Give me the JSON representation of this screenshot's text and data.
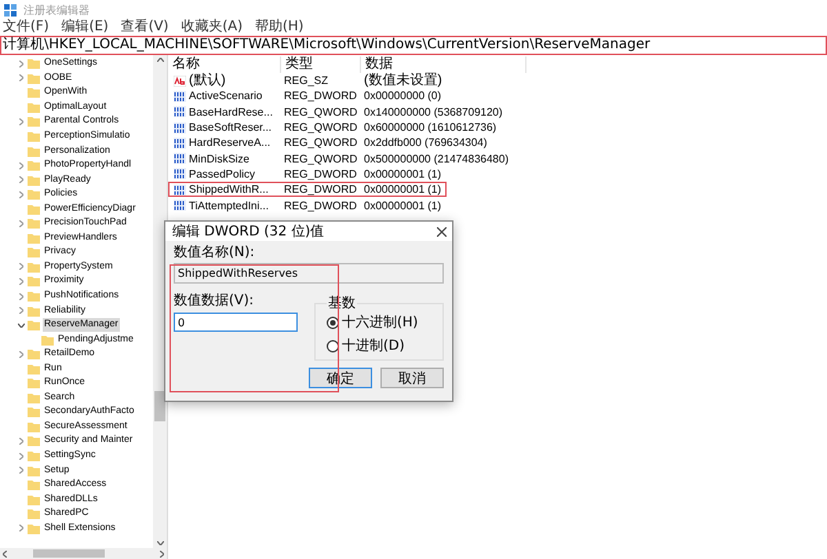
{
  "window": {
    "title": "注册表编辑器"
  },
  "menu": [
    "文件(F)",
    "编辑(E)",
    "查看(V)",
    "收藏夹(A)",
    "帮助(H)"
  ],
  "address": {
    "value": "计算机\\HKEY_LOCAL_MACHINE\\SOFTWARE\\Microsoft\\Windows\\CurrentVersion\\ReserveManager",
    "highlighted": true
  },
  "tree": [
    {
      "label": "OneSettings",
      "kind": "collapsed",
      "selected": false
    },
    {
      "label": "OOBE",
      "kind": "collapsed",
      "selected": false
    },
    {
      "label": "OpenWith",
      "kind": "leaf",
      "selected": false
    },
    {
      "label": "OptimalLayout",
      "kind": "leaf",
      "selected": false
    },
    {
      "label": "Parental Controls",
      "kind": "collapsed",
      "selected": false
    },
    {
      "label": "PerceptionSimulatio",
      "kind": "leaf",
      "selected": false
    },
    {
      "label": "Personalization",
      "kind": "leaf",
      "selected": false
    },
    {
      "label": "PhotoPropertyHandl",
      "kind": "collapsed",
      "selected": false
    },
    {
      "label": "PlayReady",
      "kind": "collapsed",
      "selected": false
    },
    {
      "label": "Policies",
      "kind": "collapsed",
      "selected": false
    },
    {
      "label": "PowerEfficiencyDiagr",
      "kind": "leaf",
      "selected": false
    },
    {
      "label": "PrecisionTouchPad",
      "kind": "collapsed",
      "selected": false
    },
    {
      "label": "PreviewHandlers",
      "kind": "leaf",
      "selected": false
    },
    {
      "label": "Privacy",
      "kind": "leaf",
      "selected": false
    },
    {
      "label": "PropertySystem",
      "kind": "collapsed",
      "selected": false
    },
    {
      "label": "Proximity",
      "kind": "collapsed",
      "selected": false
    },
    {
      "label": "PushNotifications",
      "kind": "collapsed",
      "selected": false
    },
    {
      "label": "Reliability",
      "kind": "collapsed",
      "selected": false
    },
    {
      "label": "ReserveManager",
      "kind": "expanded",
      "selected": true,
      "children": [
        {
          "label": "PendingAdjustme",
          "selected": false
        }
      ]
    },
    {
      "label": "RetailDemo",
      "kind": "collapsed",
      "selected": false
    },
    {
      "label": "Run",
      "kind": "leaf",
      "selected": false
    },
    {
      "label": "RunOnce",
      "kind": "leaf",
      "selected": false
    },
    {
      "label": "Search",
      "kind": "leaf",
      "selected": false
    },
    {
      "label": "SecondaryAuthFacto",
      "kind": "leaf",
      "selected": false
    },
    {
      "label": "SecureAssessment",
      "kind": "leaf",
      "selected": false
    },
    {
      "label": "Security and Mainter",
      "kind": "collapsed",
      "selected": false
    },
    {
      "label": "SettingSync",
      "kind": "collapsed",
      "selected": false
    },
    {
      "label": "Setup",
      "kind": "collapsed",
      "selected": false
    },
    {
      "label": "SharedAccess",
      "kind": "leaf",
      "selected": false
    },
    {
      "label": "SharedDLLs",
      "kind": "leaf",
      "selected": false
    },
    {
      "label": "SharedPC",
      "kind": "leaf",
      "selected": false
    },
    {
      "label": "Shell Extensions",
      "kind": "collapsed",
      "selected": false
    }
  ],
  "values": {
    "columns": [
      "名称",
      "类型",
      "数据"
    ],
    "rows": [
      {
        "kind": "string",
        "name": "(默认)",
        "type": "REG_SZ",
        "data": "(数值未设置)",
        "highlighted": false
      },
      {
        "kind": "number",
        "name": "ActiveScenario",
        "type": "REG_DWORD",
        "data": "0x00000000 (0)",
        "highlighted": false
      },
      {
        "kind": "number",
        "name": "BaseHardRese...",
        "type": "REG_QWORD",
        "data": "0x140000000 (5368709120)",
        "highlighted": false
      },
      {
        "kind": "number",
        "name": "BaseSoftReser...",
        "type": "REG_QWORD",
        "data": "0x60000000 (1610612736)",
        "highlighted": false
      },
      {
        "kind": "number",
        "name": "HardReserveA...",
        "type": "REG_QWORD",
        "data": "0x2ddfb000 (769634304)",
        "highlighted": false
      },
      {
        "kind": "number",
        "name": "MinDiskSize",
        "type": "REG_QWORD",
        "data": "0x500000000 (21474836480)",
        "highlighted": false
      },
      {
        "kind": "number",
        "name": "PassedPolicy",
        "type": "REG_DWORD",
        "data": "0x00000001 (1)",
        "highlighted": false
      },
      {
        "kind": "number",
        "name": "ShippedWithR...",
        "type": "REG_DWORD",
        "data": "0x00000001 (1)",
        "highlighted": true
      },
      {
        "kind": "number",
        "name": "TiAttemptedIni...",
        "type": "REG_DWORD",
        "data": "0x00000001 (1)",
        "highlighted": false
      }
    ]
  },
  "dialog": {
    "title": "编辑 DWORD (32 位)值",
    "name_label": "数值名称(N):",
    "name_value": "ShippedWithReserves",
    "data_label": "数值数据(V):",
    "data_value": "0",
    "base_label": "基数",
    "bases": [
      {
        "label": "十六进制(H)",
        "selected": true
      },
      {
        "label": "十进制(D)",
        "selected": false
      }
    ],
    "buttons": [
      "确定",
      "取消"
    ],
    "highlighted": true
  }
}
